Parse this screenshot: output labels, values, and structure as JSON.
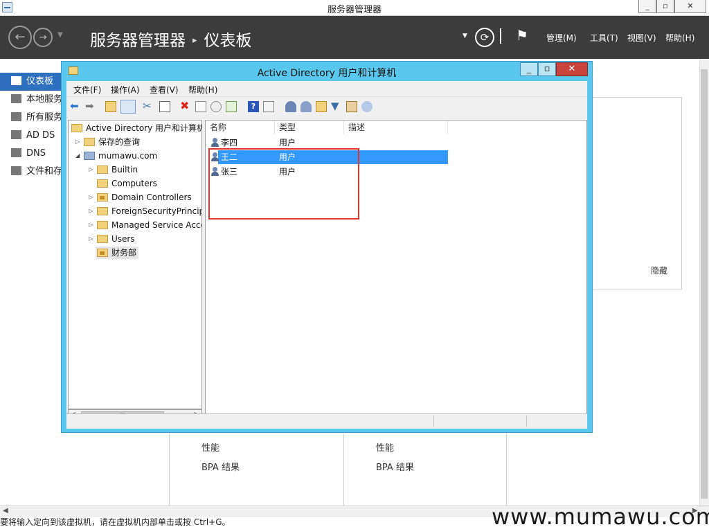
{
  "server_manager": {
    "title": "服务器管理器",
    "breadcrumb": {
      "app": "服务器管理器",
      "page": "仪表板"
    },
    "menus": [
      "管理(M)",
      "工具(T)",
      "视图(V)",
      "帮助(H)"
    ],
    "nav": [
      {
        "label": "仪表板",
        "selected": true
      },
      {
        "label": "本地服务器",
        "selected": false
      },
      {
        "label": "所有服务器",
        "selected": false
      },
      {
        "label": "AD DS",
        "selected": false
      },
      {
        "label": "DNS",
        "selected": false
      },
      {
        "label": "文件和存储服务",
        "selected": false
      }
    ],
    "hide_label": "隐藏",
    "tiles": [
      {
        "line1": "性能",
        "line2": "BPA 结果"
      },
      {
        "line1": "性能",
        "line2": "BPA 结果"
      }
    ]
  },
  "aduc": {
    "title": "Active Directory 用户和计算机",
    "menus": [
      "文件(F)",
      "操作(A)",
      "查看(V)",
      "帮助(H)"
    ],
    "tree": {
      "root": "Active Directory 用户和计算机",
      "saved_queries": "保存的查询",
      "domain": "mumawu.com",
      "children": [
        "Builtin",
        "Computers",
        "Domain Controllers",
        "ForeignSecurityPrincipals",
        "Managed Service Accounts",
        "Users",
        "财务部"
      ]
    },
    "columns": [
      "名称",
      "类型",
      "描述"
    ],
    "rows": [
      {
        "name": "李四",
        "type": "用户",
        "selected": false
      },
      {
        "name": "王二",
        "type": "用户",
        "selected": true
      },
      {
        "name": "张三",
        "type": "用户",
        "selected": false
      }
    ]
  },
  "status_text": "要将输入定向到该虚拟机，请在虚拟机内部单击或按 Ctrl+G。",
  "watermark": "www.mumawu.com",
  "colors": {
    "header_bg": "#3c3c3c",
    "selection": "#3399ff",
    "nav_selected": "#2e6fbf",
    "window_frame": "#5ac8ec",
    "highlight_box": "#e0362a"
  }
}
